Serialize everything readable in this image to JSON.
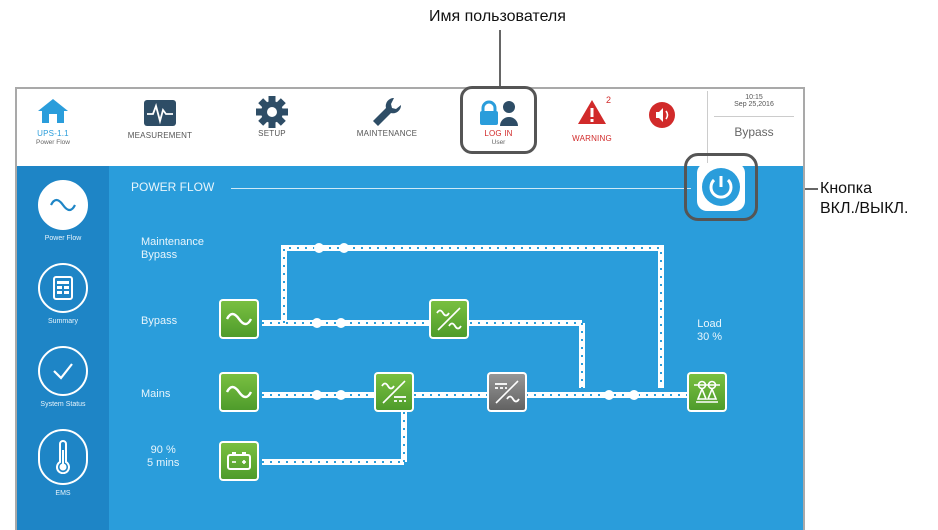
{
  "callouts": {
    "user_name": "Имя пользователя",
    "power_button": "Кнопка\nВКЛ./ВЫКЛ."
  },
  "toolbar": {
    "home": {
      "label": "UPS-1.1",
      "sub": "Power Flow",
      "icon": "home-icon"
    },
    "measurement": {
      "label": "MEASUREMENT",
      "icon": "pulse-icon"
    },
    "setup": {
      "label": "SETUP",
      "icon": "gear-icon"
    },
    "maintenance": {
      "label": "MAINTENANCE",
      "icon": "wrench-icon"
    },
    "login": {
      "label": "LOG IN",
      "sub": "User",
      "icon": "lock-user-icon"
    },
    "warning": {
      "label": "WARNING",
      "count": "2",
      "icon": "warning-icon"
    },
    "mute": {
      "icon": "speaker-icon"
    },
    "clock": {
      "time": "10:15",
      "date": "Sep 25,2016"
    },
    "mode": "Bypass"
  },
  "sidebar": {
    "items": [
      {
        "label": "Power Flow",
        "icon": "sine-wave-icon",
        "active": true
      },
      {
        "label": "Summary",
        "icon": "summary-icon",
        "active": false
      },
      {
        "label": "System Status",
        "icon": "check-icon",
        "active": false
      },
      {
        "label": "EMS",
        "icon": "thermometer-icon",
        "active": false
      }
    ]
  },
  "main": {
    "title": "POWER FLOW",
    "labels": {
      "maintenance_bypass": "Maintenance\nBypass",
      "bypass": "Bypass",
      "mains": "Mains",
      "battery": "90 %\n5 mins",
      "load": "Load\n30 %"
    }
  },
  "colors": {
    "main_bg": "#2a9ddb",
    "sidebar_bg": "#1e85c6",
    "green": "#6ab83a",
    "warning_red": "#d12a2a",
    "icon_blue": "#2a9ddb",
    "icon_dark": "#2e4d66"
  }
}
